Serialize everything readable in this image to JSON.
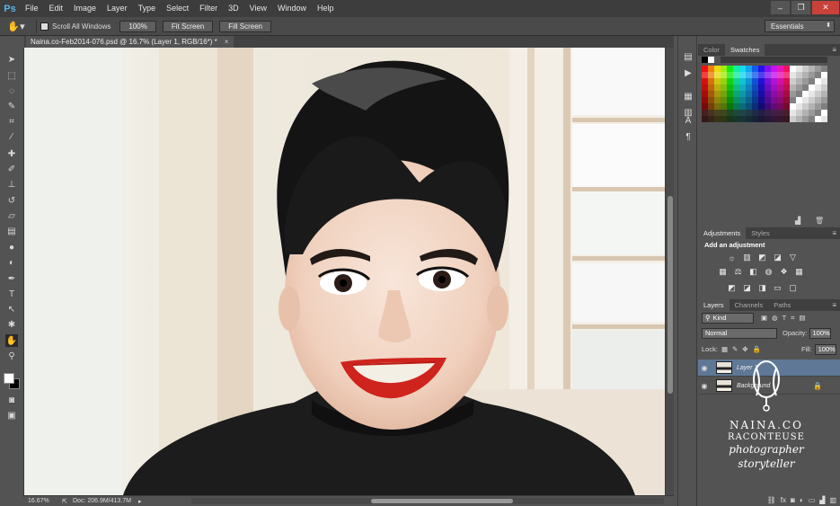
{
  "app": {
    "logo": "Ps",
    "menu": [
      "File",
      "Edit",
      "Image",
      "Layer",
      "Type",
      "Select",
      "Filter",
      "3D",
      "View",
      "Window",
      "Help"
    ],
    "window_controls": [
      "minimize-icon",
      "restore-icon",
      "close-icon"
    ]
  },
  "options_bar": {
    "tool_icon": "hand-icon",
    "scroll_all_windows_label": "Scroll All Windows",
    "scroll_all_windows_checked": false,
    "btn_100": "100%",
    "btn_fit": "Fit Screen",
    "btn_fill": "Fill Screen",
    "workspace": "Essentials"
  },
  "document": {
    "tab_title": "Naina.co-Feb2014-076.psd @ 16.7% (Layer 1, RGB/16*) *",
    "close_glyph": "×"
  },
  "status": {
    "zoom": "16.67%",
    "doc_info": "Doc: 206.9M/413.7M"
  },
  "panels": {
    "color_tab": "Color",
    "swatches_tab": "Swatches",
    "adjustments_tab": "Adjustments",
    "styles_tab": "Styles",
    "add_adjustment": "Add an adjustment",
    "layers_tab": "Layers",
    "channels_tab": "Channels",
    "paths_tab": "Paths",
    "kind_filter": "Kind",
    "blend_mode": "Normal",
    "opacity_label": "Opacity:",
    "opacity_value": "100%",
    "lock_label": "Lock:",
    "fill_label": "Fill:",
    "fill_value": "100%",
    "layers": [
      {
        "name": "Layer 1",
        "selected": true
      },
      {
        "name": "Background",
        "selected": false,
        "locked": true
      }
    ]
  },
  "watermark": {
    "name": "NAINA.CO",
    "sub": "RACONTEUSE",
    "script1": "photographer",
    "script2": "storyteller"
  },
  "colors": {
    "menubar": "#3d3d3d",
    "panel": "#535353",
    "selection": "#5f7896",
    "accent_ps": "#5ab4ea",
    "lipstick": "#d0231e"
  }
}
